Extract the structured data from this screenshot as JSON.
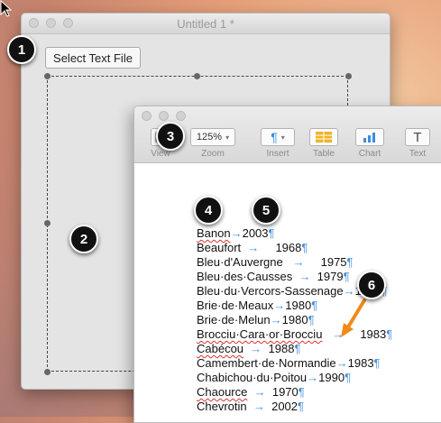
{
  "background_window": {
    "title": "Untitled 1 *",
    "select_button_label": "Select Text File"
  },
  "toolbar": {
    "view_label": "View",
    "zoom_value": "125%",
    "zoom_label": "Zoom",
    "insert_label": "Insert",
    "table_label": "Table",
    "chart_label": "Chart",
    "text_label": "Text",
    "text_glyph": "T",
    "insert_glyph": "¶"
  },
  "document_lines": [
    {
      "parts": [
        "Banon",
        "→",
        "2003",
        "¶"
      ]
    },
    {
      "parts": [
        "Beaufort",
        "  →     1968",
        "¶"
      ]
    },
    {
      "parts": [
        "Bleu·d'Auvergne",
        "   →     1975",
        "¶"
      ]
    },
    {
      "parts": [
        "Bleu·des·Causses",
        "  →  1979",
        "¶"
      ]
    },
    {
      "parts": [
        "Bleu·du·Vercors-Sassenage",
        "→",
        "1983",
        "¶"
      ]
    },
    {
      "parts": [
        "Brie·de·Meaux",
        "→",
        "1980",
        "¶"
      ]
    },
    {
      "parts": [
        "Brie·de·Melun",
        "→",
        "1980",
        "¶"
      ]
    },
    {
      "parts": [
        "Brocciu·Cara·or·Brocciu",
        "   →     1983",
        "¶"
      ]
    },
    {
      "parts": [
        "Cabécou",
        "  →  1988",
        "¶"
      ]
    },
    {
      "parts": [
        "Camembert·de·Normandie",
        "→",
        "1983",
        "¶"
      ]
    },
    {
      "parts": [
        "Chabichou·du·Poitou",
        "→",
        "1990",
        "¶"
      ]
    },
    {
      "parts": [
        "Chaource",
        "  →  1970",
        "¶"
      ]
    },
    {
      "parts": [
        "Chevrotin",
        "  →  2002",
        "¶"
      ]
    }
  ],
  "callouts": [
    "1",
    "2",
    "3",
    "4",
    "5",
    "6"
  ],
  "colors": {
    "callout_bg": "#111111",
    "tab_marks": "#4a90d9",
    "arrow": "#f08a1c",
    "accent_blue": "#3b8de0",
    "accent_yellow": "#f0b429"
  }
}
